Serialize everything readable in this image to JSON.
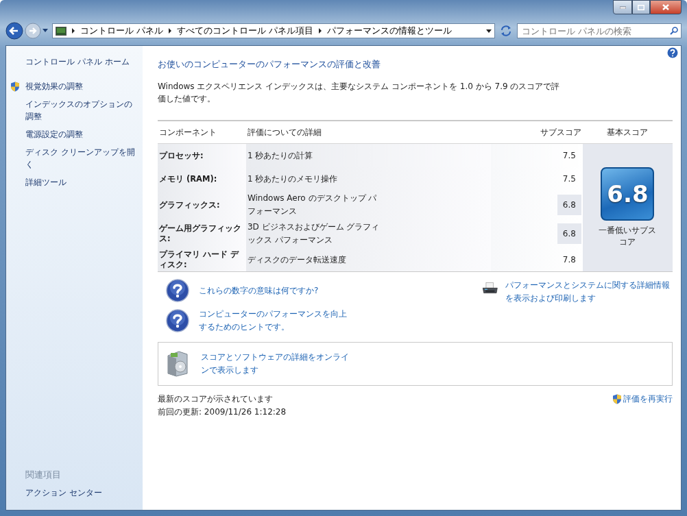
{
  "address_bar": {
    "breadcrumbs": [
      "コントロール パネル",
      "すべてのコントロール パネル項目",
      "パフォーマンスの情報とツール"
    ]
  },
  "search": {
    "placeholder": "コントロール パネルの検索"
  },
  "sidebar": {
    "home": "コントロール パネル ホーム",
    "items": [
      {
        "label": "視覚効果の調整",
        "kind": "shield"
      },
      {
        "label": "インデックスのオプションの調整",
        "kind": "plain"
      },
      {
        "label": "電源設定の調整",
        "kind": "plain"
      },
      {
        "label": "ディスク クリーンアップを開く",
        "kind": "plain"
      },
      {
        "label": "詳細ツール",
        "kind": "plain"
      }
    ],
    "related_heading": "関連項目",
    "related_items": [
      "アクション センター"
    ]
  },
  "main": {
    "heading": "お使いのコンピューターのパフォーマンスの評価と改善",
    "description": "Windows エクスペリエンス インデックスは、主要なシステム コンポーネントを 1.0 から 7.9 のスコアで評価した値です。",
    "table": {
      "columns": [
        "コンポーネント",
        "評価についての詳細",
        "サブスコア",
        "基本スコア"
      ],
      "rows": [
        {
          "component": "プロセッサ:",
          "detail": "1 秒あたりの計算",
          "subscore": "7.5",
          "lowest": false
        },
        {
          "component": "メモリ (RAM):",
          "detail": "1 秒あたりのメモリ操作",
          "subscore": "7.5",
          "lowest": false
        },
        {
          "component": "グラフィックス:",
          "detail": "Windows Aero のデスクトップ パフォーマンス",
          "subscore": "6.8",
          "lowest": true
        },
        {
          "component": "ゲーム用グラフィックス:",
          "detail": "3D ビジネスおよびゲーム グラフィックス パフォーマンス",
          "subscore": "6.8",
          "lowest": true
        },
        {
          "component": "プライマリ ハード ディスク:",
          "detail": "ディスクのデータ転送速度",
          "subscore": "7.8",
          "lowest": false
        }
      ],
      "base_score": "6.8",
      "base_caption": "一番低いサブスコア"
    },
    "help_links": [
      "これらの数字の意味は何ですか?",
      "コンピューターのパフォーマンスを向上するためのヒントです。"
    ],
    "print_link": "パフォーマンスとシステムに関する詳細情報を表示および印刷します",
    "online_link": "スコアとソフトウェアの詳細をオンラインで表示します",
    "status": "最新のスコアが示されています",
    "last_update": "前回の更新: 2009/11/26 1:12:28",
    "rerun": "評価を再実行"
  }
}
